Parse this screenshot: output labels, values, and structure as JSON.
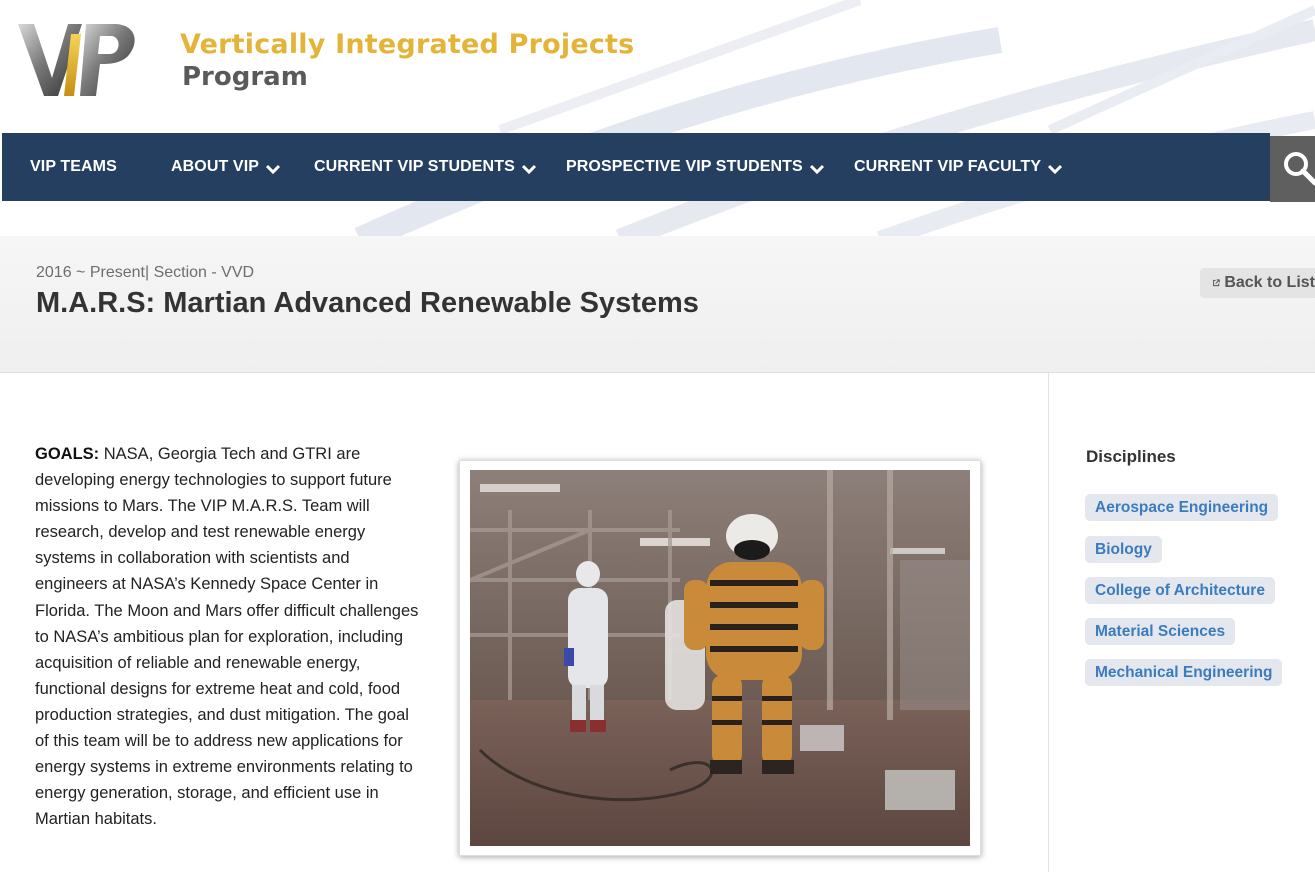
{
  "site": {
    "logo_text": "VIP",
    "title_line1": "Vertically Integrated Projects",
    "title_line2": "Program"
  },
  "nav": {
    "items": [
      {
        "label": "VIP TEAMS",
        "has_dropdown": false
      },
      {
        "label": "ABOUT VIP",
        "has_dropdown": true
      },
      {
        "label": "CURRENT VIP STUDENTS",
        "has_dropdown": true
      },
      {
        "label": "PROSPECTIVE VIP STUDENTS",
        "has_dropdown": true
      },
      {
        "label": "CURRENT VIP FACULTY",
        "has_dropdown": true
      }
    ],
    "search_icon": "search-icon"
  },
  "banner": {
    "meta": "2016 ~ Present| Section - VVD",
    "title": "M.A.R.S: Martian Advanced Renewable Systems",
    "back_label": "Back to List",
    "back_icon": "external-link-icon"
  },
  "goals": {
    "label": "GOALS:",
    "text": " NASA, Georgia Tech and GTRI are developing energy technologies to support future missions to Mars. The VIP M.A.R.S. Team will research, develop and test renewable energy systems in collaboration with scientists and engineers at NASA’s Kennedy Space Center in Florida. The Moon and Mars offer difficult challenges to NASA’s ambitious plan for exploration, including acquisition of reliable and renewable energy, functional designs for extreme heat and cold, food production strategies, and dust mitigation. The goal of this team will be to address new applications for energy systems in extreme environments relating to energy generation, storage, and efficient use in Martian habitats."
  },
  "sidebar": {
    "title": "Disciplines",
    "tags": [
      "Aerospace Engineering",
      "Biology",
      "College of Architecture",
      "Material Sciences",
      "Mechanical Engineering"
    ]
  },
  "colors": {
    "nav_bg": "#253f61",
    "title_gold": "#e3b437",
    "tag_text": "#3b7bbf",
    "tag_bg": "#e4e8ee"
  }
}
